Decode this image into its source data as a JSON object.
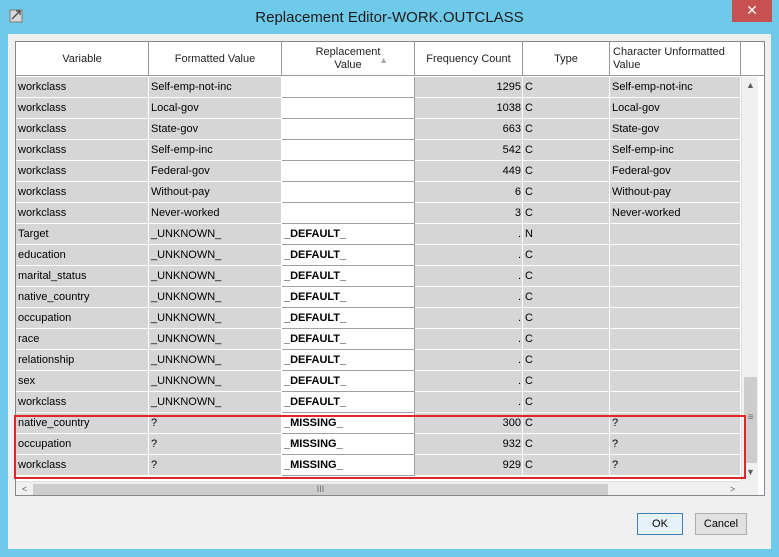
{
  "window": {
    "title": "Replacement Editor-WORK.OUTCLASS",
    "close_glyph": "✕"
  },
  "columns": [
    {
      "label": "Variable"
    },
    {
      "label": "Formatted Value"
    },
    {
      "label": "Replacement\nValue",
      "sort_icon": "▲"
    },
    {
      "label": "Frequency Count"
    },
    {
      "label": "Type"
    },
    {
      "label": "Character Unformatted Value"
    }
  ],
  "rows": [
    {
      "variable": "workclass",
      "formatted": "Self-emp-not-inc",
      "replacement": "",
      "frequency": "1295",
      "type": "C",
      "unformatted": "Self-emp-not-inc"
    },
    {
      "variable": "workclass",
      "formatted": "Local-gov",
      "replacement": "",
      "frequency": "1038",
      "type": "C",
      "unformatted": "Local-gov"
    },
    {
      "variable": "workclass",
      "formatted": "State-gov",
      "replacement": "",
      "frequency": "663",
      "type": "C",
      "unformatted": "State-gov"
    },
    {
      "variable": "workclass",
      "formatted": "Self-emp-inc",
      "replacement": "",
      "frequency": "542",
      "type": "C",
      "unformatted": "Self-emp-inc"
    },
    {
      "variable": "workclass",
      "formatted": "Federal-gov",
      "replacement": "",
      "frequency": "449",
      "type": "C",
      "unformatted": "Federal-gov"
    },
    {
      "variable": "workclass",
      "formatted": "Without-pay",
      "replacement": "",
      "frequency": "6",
      "type": "C",
      "unformatted": "Without-pay"
    },
    {
      "variable": "workclass",
      "formatted": "Never-worked",
      "replacement": "",
      "frequency": "3",
      "type": "C",
      "unformatted": "Never-worked"
    },
    {
      "variable": "Target",
      "formatted": "_UNKNOWN_",
      "replacement": "_DEFAULT_",
      "frequency": ".",
      "type": "N",
      "unformatted": ""
    },
    {
      "variable": "education",
      "formatted": "_UNKNOWN_",
      "replacement": "_DEFAULT_",
      "frequency": ".",
      "type": "C",
      "unformatted": ""
    },
    {
      "variable": "marital_status",
      "formatted": "_UNKNOWN_",
      "replacement": "_DEFAULT_",
      "frequency": ".",
      "type": "C",
      "unformatted": ""
    },
    {
      "variable": "native_country",
      "formatted": "_UNKNOWN_",
      "replacement": "_DEFAULT_",
      "frequency": ".",
      "type": "C",
      "unformatted": ""
    },
    {
      "variable": "occupation",
      "formatted": "_UNKNOWN_",
      "replacement": "_DEFAULT_",
      "frequency": ".",
      "type": "C",
      "unformatted": ""
    },
    {
      "variable": "race",
      "formatted": "_UNKNOWN_",
      "replacement": "_DEFAULT_",
      "frequency": ".",
      "type": "C",
      "unformatted": ""
    },
    {
      "variable": "relationship",
      "formatted": "_UNKNOWN_",
      "replacement": "_DEFAULT_",
      "frequency": ".",
      "type": "C",
      "unformatted": ""
    },
    {
      "variable": "sex",
      "formatted": "_UNKNOWN_",
      "replacement": "_DEFAULT_",
      "frequency": ".",
      "type": "C",
      "unformatted": ""
    },
    {
      "variable": "workclass",
      "formatted": "_UNKNOWN_",
      "replacement": "_DEFAULT_",
      "frequency": ".",
      "type": "C",
      "unformatted": ""
    },
    {
      "variable": "native_country",
      "formatted": "?",
      "replacement": "_MISSING_",
      "frequency": "300",
      "type": "C",
      "unformatted": "?"
    },
    {
      "variable": "occupation",
      "formatted": "?",
      "replacement": "_MISSING_",
      "frequency": "932",
      "type": "C",
      "unformatted": "?"
    },
    {
      "variable": "workclass",
      "formatted": "?",
      "replacement": "_MISSING_",
      "frequency": "929",
      "type": "C",
      "unformatted": "?"
    }
  ],
  "scrollbars": {
    "up": "▲",
    "down": "▼",
    "left": "<",
    "right": ">",
    "v_grip": "≡",
    "h_grip": "III"
  },
  "buttons": {
    "ok": "OK",
    "cancel": "Cancel"
  },
  "colors": {
    "titlebar": "#6fcaea",
    "close": "#c75050",
    "cell_bg": "#d6d6d6",
    "highlight": "#e0262b"
  }
}
